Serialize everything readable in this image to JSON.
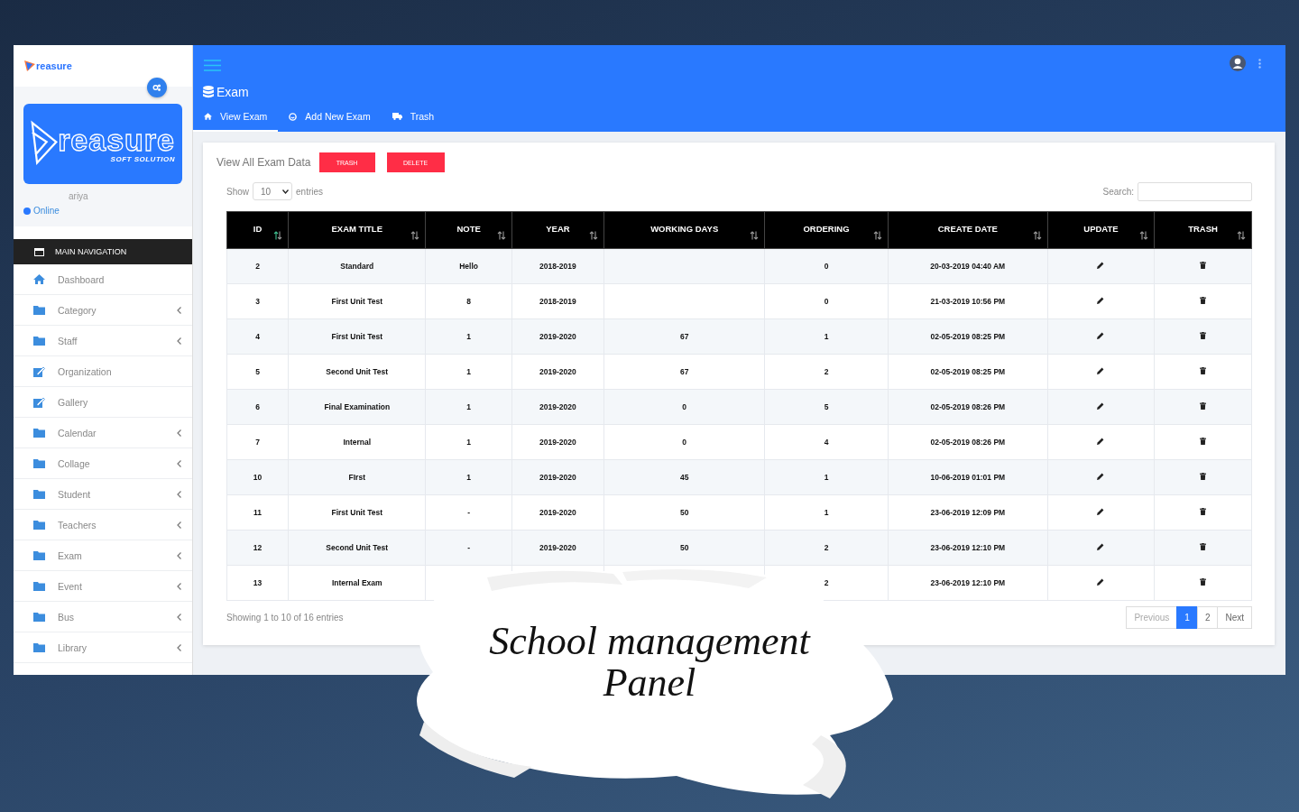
{
  "sidebar": {
    "small_logo": "reasure",
    "logo": {
      "title": "reasure",
      "subtitle": "SOFT SOLUTION"
    },
    "user": {
      "name": "ariya",
      "status": "Online"
    },
    "section": "MAIN NAVIGATION",
    "items": [
      {
        "label": "Dashboard",
        "kind": "home",
        "expandable": false
      },
      {
        "label": "Category",
        "kind": "folder",
        "expandable": true
      },
      {
        "label": "Staff",
        "kind": "folder",
        "expandable": true
      },
      {
        "label": "Organization",
        "kind": "edit",
        "expandable": false
      },
      {
        "label": "Gallery",
        "kind": "edit",
        "expandable": false
      },
      {
        "label": "Calendar",
        "kind": "folder",
        "expandable": true
      },
      {
        "label": "Collage",
        "kind": "folder",
        "expandable": true
      },
      {
        "label": "Student",
        "kind": "folder",
        "expandable": true
      },
      {
        "label": "Teachers",
        "kind": "folder",
        "expandable": true
      },
      {
        "label": "Exam",
        "kind": "folder",
        "expandable": true
      },
      {
        "label": "Event",
        "kind": "folder",
        "expandable": true
      },
      {
        "label": "Bus",
        "kind": "folder",
        "expandable": true
      },
      {
        "label": "Library",
        "kind": "folder",
        "expandable": true
      }
    ]
  },
  "header": {
    "title": "Exam",
    "tabs": [
      {
        "label": "View Exam",
        "kind": "home",
        "selected": true
      },
      {
        "label": "Add New Exam",
        "kind": "face",
        "selected": false
      },
      {
        "label": "Trash",
        "kind": "truck",
        "selected": false
      }
    ]
  },
  "card": {
    "title": "View All Exam Data",
    "buttons": [
      "TRASH",
      "DELETE"
    ],
    "show_label": "Show",
    "page_size": "10",
    "entries_label": "entries",
    "search_label": "Search:"
  },
  "table": {
    "columns": [
      {
        "label": "ID",
        "sorted": true
      },
      {
        "label": "EXAM TITLE",
        "sorted": false
      },
      {
        "label": "NOTE",
        "sorted": false
      },
      {
        "label": "YEAR",
        "sorted": false
      },
      {
        "label": "WORKING DAYS",
        "sorted": false
      },
      {
        "label": "ORDERING",
        "sorted": false
      },
      {
        "label": "CREATE DATE",
        "sorted": false
      },
      {
        "label": "UPDATE",
        "sorted": false
      },
      {
        "label": "TRASH",
        "sorted": false
      }
    ],
    "rows": [
      {
        "id": "2",
        "title": "Standard",
        "note": "Hello",
        "year": "2018-2019",
        "ordering": "0",
        "create_date": "20-03-2019 04:40 AM"
      },
      {
        "id": "3",
        "title": "First Unit Test",
        "note": "8",
        "year": "2018-2019",
        "ordering": "0",
        "create_date": "21-03-2019 10:56 PM"
      },
      {
        "id": "4",
        "title": "First Unit Test",
        "note": "1",
        "year": "2019-2020",
        "working_days": "67",
        "ordering": "1",
        "create_date": "02-05-2019 08:25 PM"
      },
      {
        "id": "5",
        "title": "Second Unit Test",
        "note": "1",
        "year": "2019-2020",
        "working_days": "67",
        "ordering": "2",
        "create_date": "02-05-2019 08:25 PM"
      },
      {
        "id": "6",
        "title": "Final Examination",
        "note": "1",
        "year": "2019-2020",
        "working_days": "0",
        "ordering": "5",
        "create_date": "02-05-2019 08:26 PM"
      },
      {
        "id": "7",
        "title": "Internal",
        "note": "1",
        "year": "2019-2020",
        "working_days": "0",
        "ordering": "4",
        "create_date": "02-05-2019 08:26 PM"
      },
      {
        "id": "10",
        "title": "FIrst",
        "note": "1",
        "year": "2019-2020",
        "working_days": "45",
        "ordering": "1",
        "create_date": "10-06-2019 01:01 PM"
      },
      {
        "id": "11",
        "title": "First Unit Test",
        "note": "-",
        "year": "2019-2020",
        "working_days": "50",
        "ordering": "1",
        "create_date": "23-06-2019 12:09 PM"
      },
      {
        "id": "12",
        "title": "Second Unit Test",
        "note": "-",
        "year": "2019-2020",
        "working_days": "50",
        "ordering": "2",
        "create_date": "23-06-2019 12:10 PM"
      },
      {
        "id": "13",
        "title": "Internal Exam",
        "ordering": "2",
        "create_date": "23-06-2019 12:10 PM"
      }
    ]
  },
  "footer": {
    "info": "Showing 1 to 10 of 16 entries",
    "pages": [
      {
        "label": "Previous",
        "selected": false
      },
      {
        "label": "1",
        "selected": true
      },
      {
        "label": "2",
        "selected": false
      },
      {
        "label": "Next",
        "selected": false
      }
    ]
  },
  "caption": "School management Panel"
}
